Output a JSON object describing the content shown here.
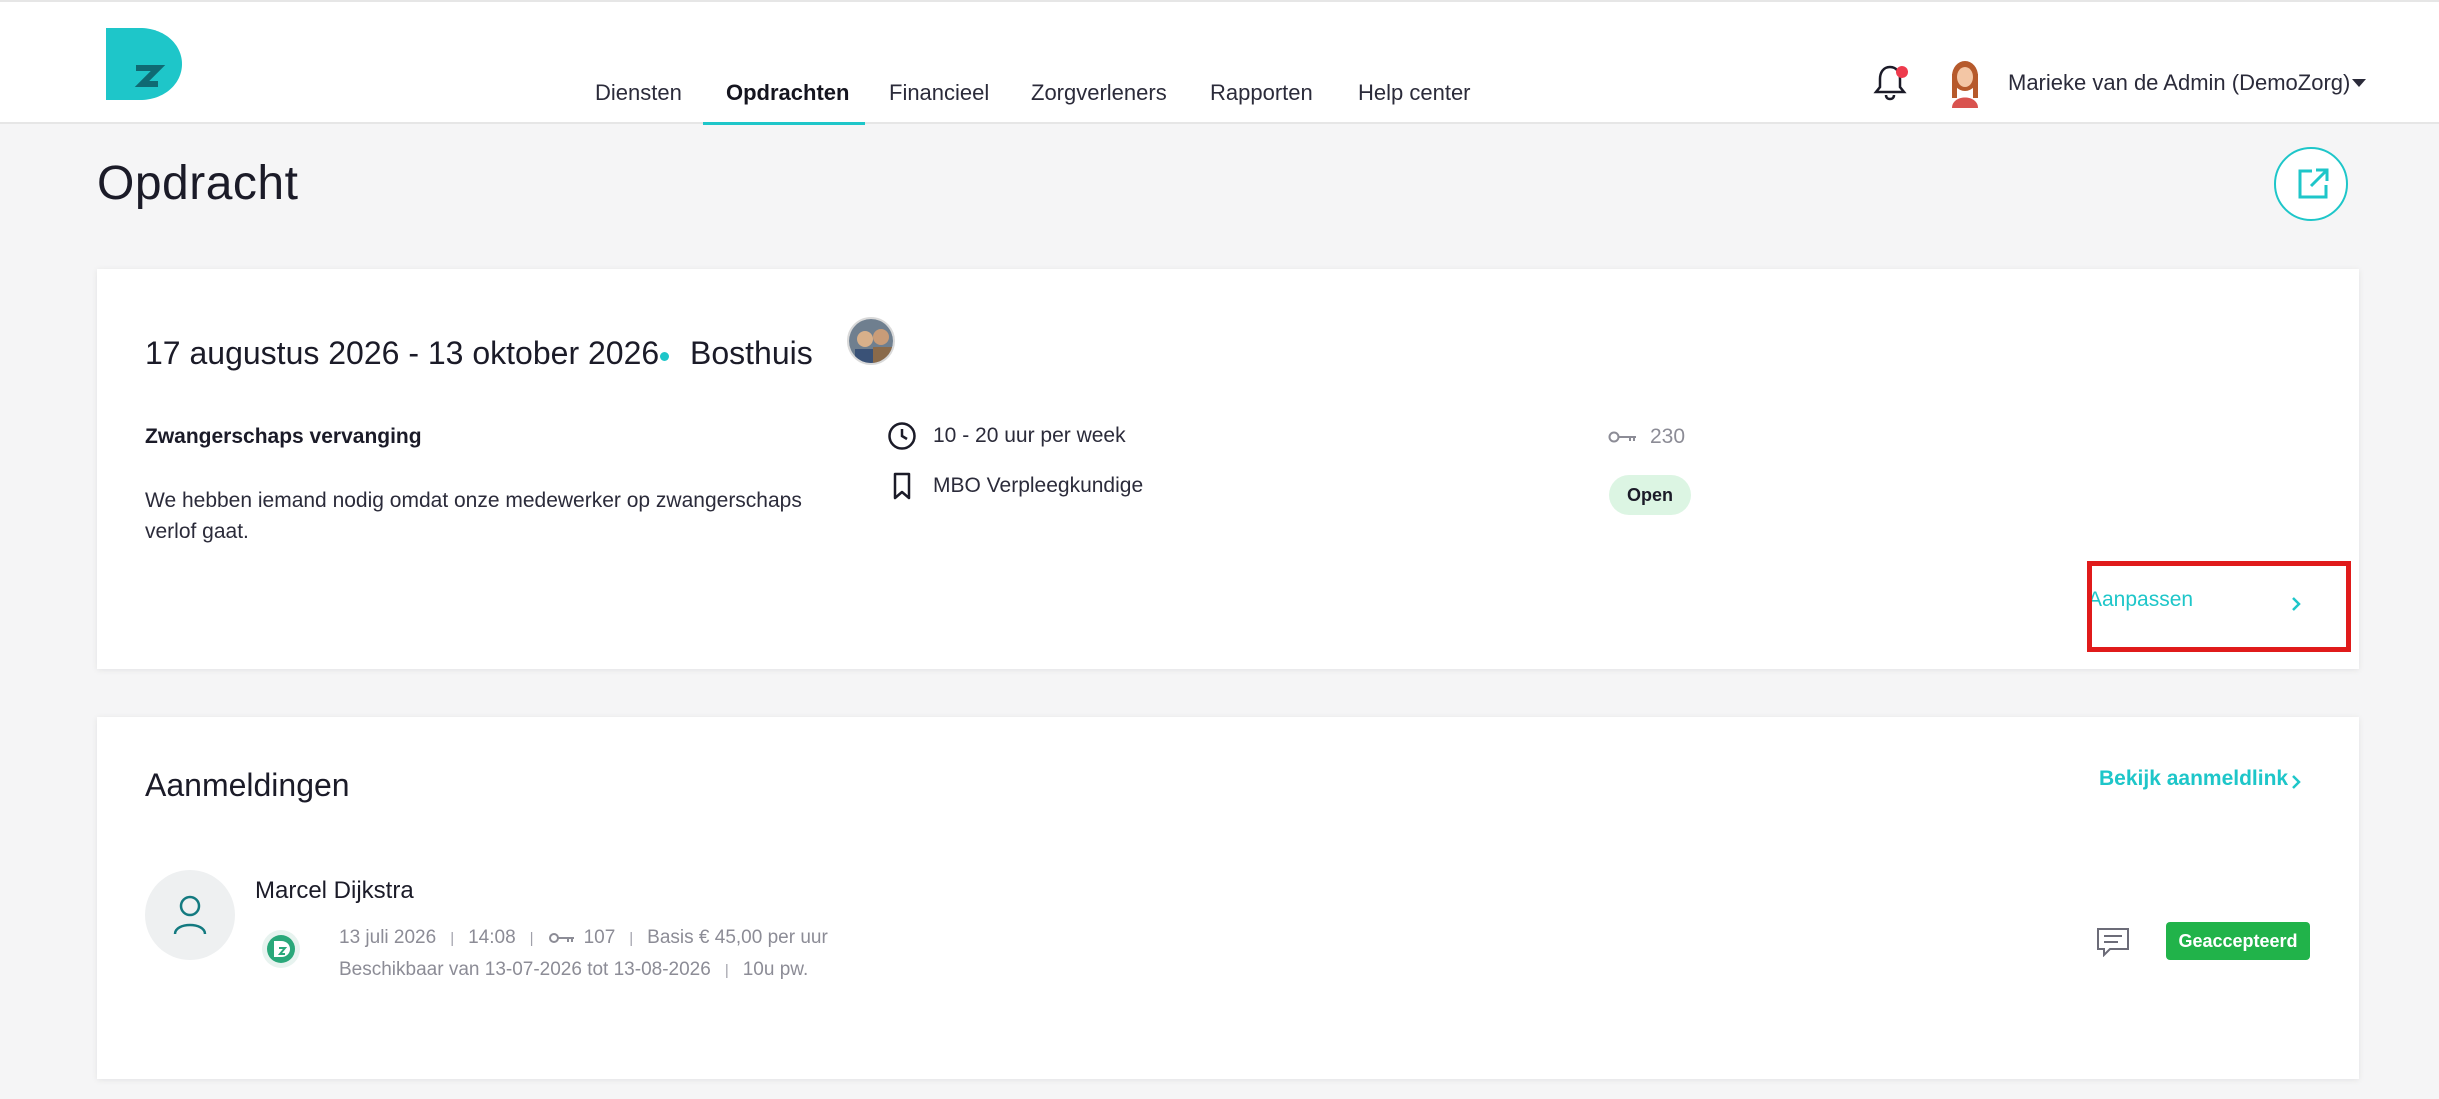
{
  "nav": {
    "items": [
      {
        "label": "Diensten",
        "active": false
      },
      {
        "label": "Opdrachten",
        "active": true
      },
      {
        "label": "Financieel",
        "active": false
      },
      {
        "label": "Zorgverleners",
        "active": false
      },
      {
        "label": "Rapporten",
        "active": false
      },
      {
        "label": "Help center",
        "active": false
      }
    ]
  },
  "user": {
    "name": "Marieke van de Admin (DemoZorg)",
    "has_notification": true
  },
  "page": {
    "title": "Opdracht"
  },
  "job": {
    "date_range": "17 augustus 2026 - 13 oktober 2026",
    "location": "Bosthuis",
    "type": "Zwangerschaps vervanging",
    "description": "We hebben iemand nodig omdat onze medewerker op zwangerschaps verlof gaat.",
    "hours": "10 - 20 uur per week",
    "role": "MBO Verpleegkundige",
    "id": "230",
    "status": "Open",
    "edit_label": "Aanpassen"
  },
  "applications": {
    "title": "Aanmeldingen",
    "link_label": "Bekijk aanmeldlink",
    "items": [
      {
        "name": "Marcel Dijkstra",
        "date": "13 juli 2026",
        "time": "14:08",
        "id": "107",
        "rate": "Basis € 45,00 per uur",
        "availability": "Beschikbaar van 13-07-2026 tot 13-08-2026",
        "hours": "10u pw.",
        "status": "Geaccepteerd"
      }
    ]
  },
  "colors": {
    "accent": "#1ec6c9",
    "status_open_bg": "#dcf5e3",
    "status_accepted_bg": "#21b34a",
    "notification_dot": "#ee3b4d",
    "highlight": "#e01b1b"
  }
}
